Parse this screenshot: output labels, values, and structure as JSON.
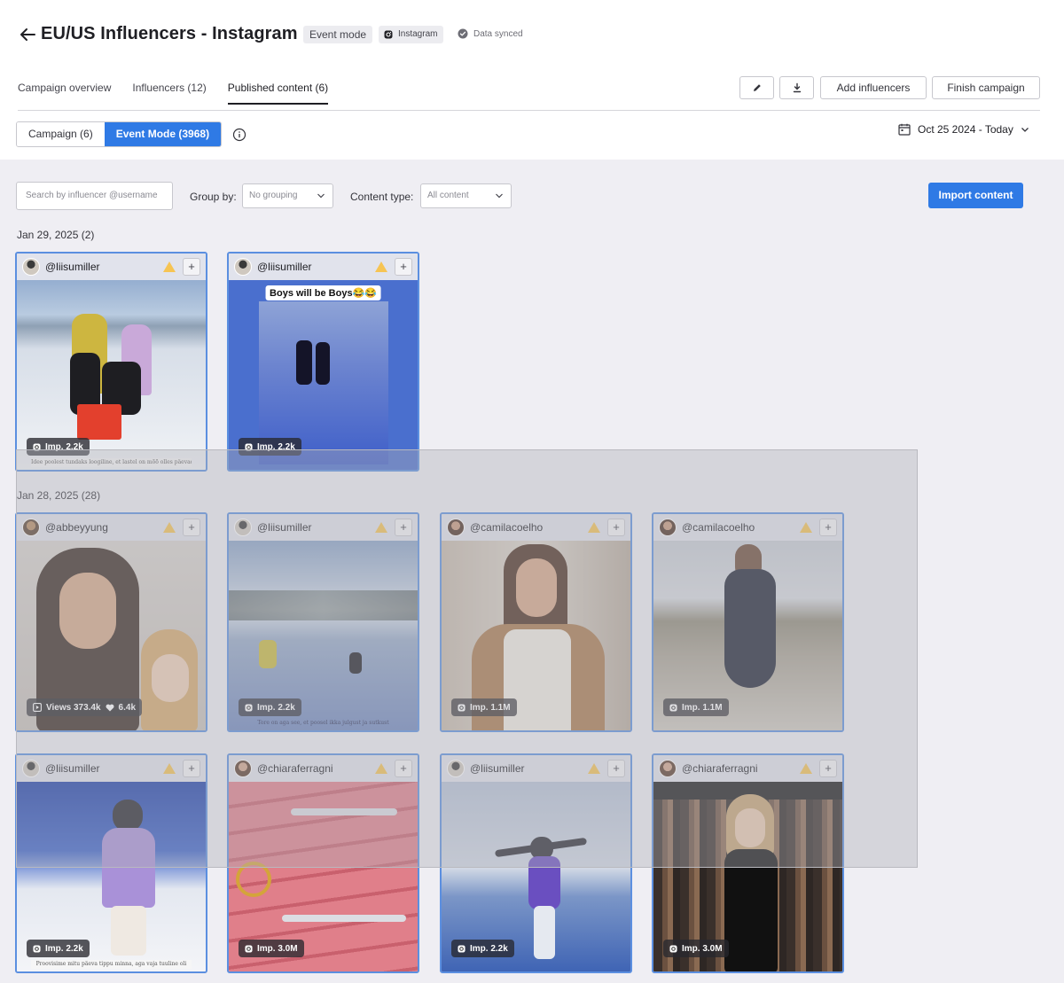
{
  "header": {
    "title": "EU/US Influencers - Instagram",
    "mode_badge": "Event mode",
    "platform_badge": "Instagram",
    "sync_status": "Data synced"
  },
  "tabs": [
    {
      "label": "Campaign overview",
      "active": false
    },
    {
      "label": "Influencers (12)",
      "active": false
    },
    {
      "label": "Published content (6)",
      "active": true
    }
  ],
  "toolbar": {
    "add_influencers": "Add influencers",
    "finish_campaign": "Finish campaign"
  },
  "segment": {
    "campaign": "Campaign (6)",
    "event_mode": "Event Mode (3968)"
  },
  "date_range": "Oct 25 2024 - Today",
  "filters": {
    "search_placeholder": "Search by influencer @username",
    "group_by_label": "Group by:",
    "group_by_value": "No grouping",
    "content_type_label": "Content type:",
    "content_type_value": "All content",
    "import_label": "Import content"
  },
  "groups": [
    {
      "date": "Jan 29, 2025 (2)",
      "cards": [
        {
          "handle": "@liisumiller",
          "metric": "Imp. 2.2k",
          "subtitle": "Idee poolest tundaks loogiline, et lastel on mõõ olles päevad us"
        },
        {
          "handle": "@liisumiller",
          "metric": "Imp. 2.2k",
          "caption": "Boys will be Boys😂😂"
        }
      ]
    },
    {
      "date": "Jan 28, 2025 (28)",
      "cards": [
        {
          "handle": "@abbeyyung",
          "metric_views": "Views 373.4k",
          "metric_likes": "6.4k"
        },
        {
          "handle": "@liisumiller",
          "metric": "Imp. 2.2k",
          "subtitle": "Tore on aga see, et poosel ikka julgust ja sutkust"
        },
        {
          "handle": "@camilacoelho",
          "metric": "Imp. 1.1M"
        },
        {
          "handle": "@camilacoelho",
          "metric": "Imp. 1.1M"
        },
        {
          "handle": "@liisumiller",
          "metric": "Imp. 2.2k",
          "subtitle": "Proovisime mitu päeva tippu minna, aga vaja tuuline oli"
        },
        {
          "handle": "@chiaraferragni",
          "metric": "Imp. 3.0M"
        },
        {
          "handle": "@liisumiller",
          "metric": "Imp. 2.2k"
        },
        {
          "handle": "@chiaraferragni",
          "metric": "Imp. 3.0M"
        }
      ]
    }
  ],
  "colors": {
    "accent": "#2f7ae5",
    "card_border": "#5b8fe0",
    "warning": "#f6c453",
    "background": "#efeef3"
  }
}
